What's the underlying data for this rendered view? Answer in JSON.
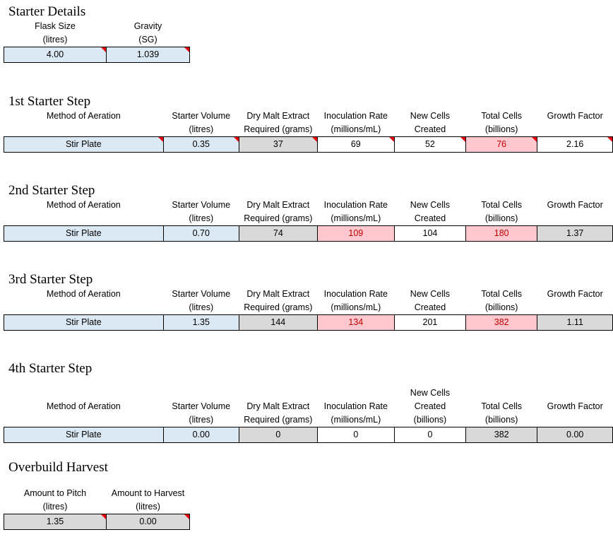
{
  "sections": {
    "starter_details": {
      "title": "Starter Details",
      "headers": [
        {
          "line1": "Flask Size",
          "line2": "(litres)"
        },
        {
          "line1": "Gravity",
          "line2": "(SG)"
        }
      ],
      "values": [
        "4.00",
        "1.039"
      ]
    },
    "step1": {
      "title": "1st Starter Step",
      "headers": [
        {
          "line1": "Method of Aeration",
          "line2": ""
        },
        {
          "line1": "Starter Volume",
          "line2": "(litres)"
        },
        {
          "line1": "Dry Malt Extract",
          "line2": "Required (grams)"
        },
        {
          "line1": "Inoculation Rate",
          "line2": "(millions/mL)"
        },
        {
          "line1": "New Cells",
          "line2": "Created"
        },
        {
          "line1": "Total Cells",
          "line2": "(billions)"
        },
        {
          "line1": "Growth Factor",
          "line2": ""
        }
      ],
      "values": [
        "Stir Plate",
        "0.35",
        "37",
        "69",
        "52",
        "76",
        "2.16"
      ]
    },
    "step2": {
      "title": "2nd Starter Step",
      "headers": [
        {
          "line1": "Method of Aeration",
          "line2": ""
        },
        {
          "line1": "Starter Volume",
          "line2": "(litres)"
        },
        {
          "line1": "Dry Malt Extract",
          "line2": "Required (grams)"
        },
        {
          "line1": "Inoculation Rate",
          "line2": "(millions/mL)"
        },
        {
          "line1": "New Cells",
          "line2": "Created"
        },
        {
          "line1": "Total Cells",
          "line2": "(billions)"
        },
        {
          "line1": "Growth Factor",
          "line2": ""
        }
      ],
      "values": [
        "Stir Plate",
        "0.70",
        "74",
        "109",
        "104",
        "180",
        "1.37"
      ]
    },
    "step3": {
      "title": "3rd Starter Step",
      "headers": [
        {
          "line1": "Method of Aeration",
          "line2": ""
        },
        {
          "line1": "Starter Volume",
          "line2": "(litres)"
        },
        {
          "line1": "Dry Malt Extract",
          "line2": "Required (grams)"
        },
        {
          "line1": "Inoculation Rate",
          "line2": "(millions/mL)"
        },
        {
          "line1": "New Cells",
          "line2": "Created"
        },
        {
          "line1": "Total Cells",
          "line2": "(billions)"
        },
        {
          "line1": "Growth Factor",
          "line2": ""
        }
      ],
      "values": [
        "Stir Plate",
        "1.35",
        "144",
        "134",
        "201",
        "382",
        "1.11"
      ]
    },
    "step4": {
      "title": "4th Starter Step",
      "headers": [
        {
          "line0": "",
          "line1": "Method of Aeration",
          "line2": ""
        },
        {
          "line0": "",
          "line1": "Starter Volume",
          "line2": "(litres)"
        },
        {
          "line0": "",
          "line1": "Dry Malt Extract",
          "line2": "Required (grams)"
        },
        {
          "line0": "",
          "line1": "Inoculation Rate",
          "line2": "(millions/mL)"
        },
        {
          "line0": "New Cells",
          "line1": "Created",
          "line2": "(billions)"
        },
        {
          "line0": "",
          "line1": "Total Cells",
          "line2": "(billions)"
        },
        {
          "line0": "",
          "line1": "Growth Factor",
          "line2": ""
        }
      ],
      "values": [
        "Stir Plate",
        "0.00",
        "0",
        "0",
        "0",
        "382",
        "0.00"
      ]
    },
    "overbuild": {
      "title": "Overbuild Harvest",
      "headers": [
        {
          "line1": "Amount to Pitch",
          "line2": "(litres)"
        },
        {
          "line1": "Amount to Harvest",
          "line2": "(litres)"
        }
      ],
      "values": [
        "1.35",
        "0.00"
      ]
    }
  },
  "colors": {
    "input_blue": "#dbe9f4",
    "calc_gray": "#d9d9d9",
    "warning_pink": "#ffc7ce",
    "warning_text": "#c00000",
    "comment_marker": "#e8000d"
  }
}
